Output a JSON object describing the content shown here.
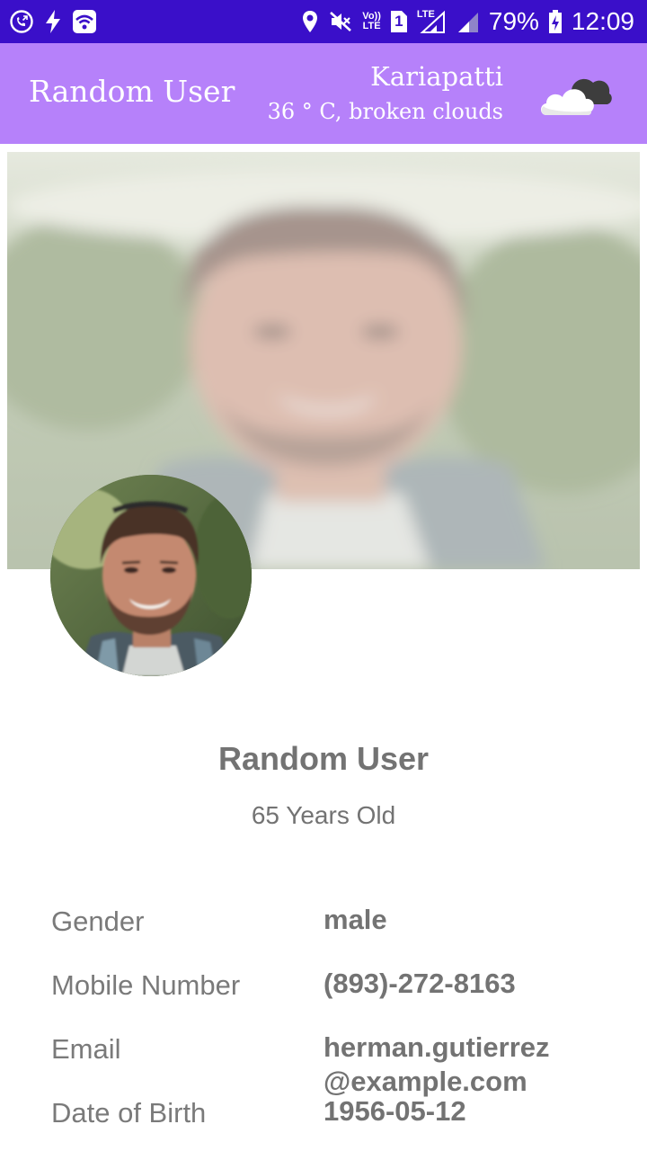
{
  "status_bar": {
    "battery": "79%",
    "time": "12:09",
    "volte": "Vo))\nLTE",
    "sim": "1",
    "lte": "LTE",
    "icons": [
      "call-forward-icon",
      "flash-icon",
      "wifi-icon",
      "location-icon",
      "mute-icon",
      "volte-icon",
      "sim-icon",
      "signal-icon",
      "battery-charging-icon"
    ]
  },
  "app_bar": {
    "title": "Random User",
    "city": "Kariapatti",
    "weather": "36 ° C, broken clouds",
    "weather_icon": "cloud-icon"
  },
  "profile": {
    "name": "Random User",
    "age": "65 Years Old"
  },
  "details": [
    {
      "label": "Gender",
      "value": "male"
    },
    {
      "label": "Mobile Number",
      "value": "(893)-272-8163"
    },
    {
      "label": "Email",
      "value_line1": "herman.gutierrez",
      "value_line2": "@example.com"
    },
    {
      "label": "Date of Birth",
      "value": "1956-05-12"
    }
  ],
  "colors": {
    "status_bar": "#3a0fc9",
    "app_bar": "#b681fa",
    "text_gray": "#737373"
  }
}
